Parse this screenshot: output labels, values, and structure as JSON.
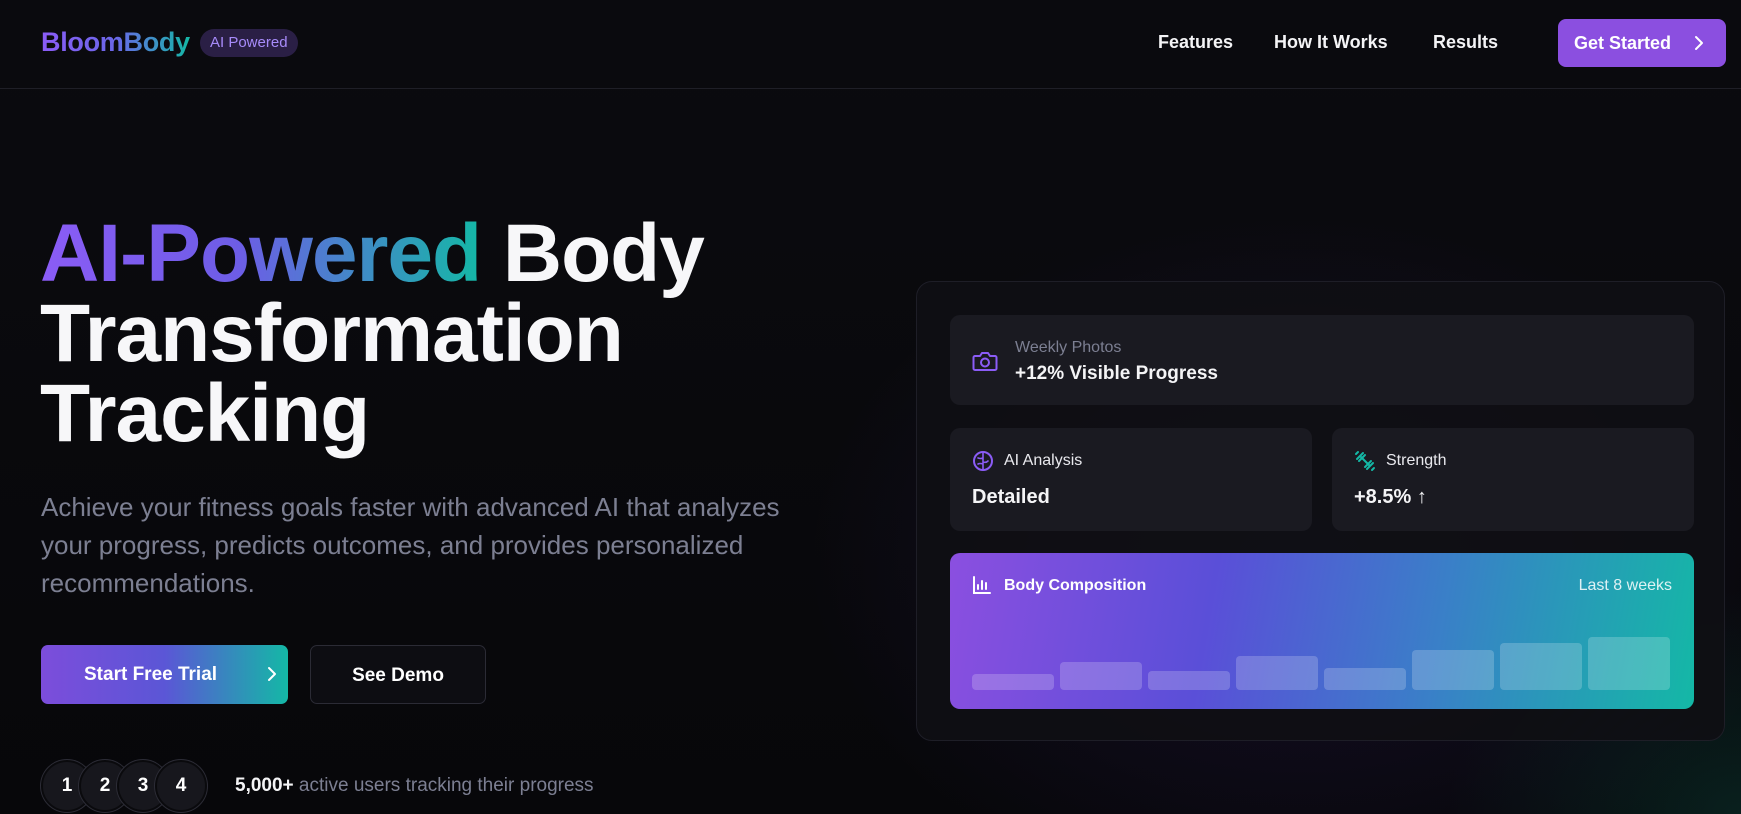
{
  "nav": {
    "logo": "BloomBody",
    "badge": "AI Powered",
    "links": [
      "Features",
      "How It Works",
      "Results"
    ],
    "cta": "Get Started"
  },
  "hero": {
    "title_gradient": "AI-Powered",
    "title_rest_1": " Body",
    "title_line_2": "Transformation",
    "title_line_3": "Tracking",
    "subtitle": "Achieve your fitness goals faster with advanced AI that analyzes your progress, predicts outcomes, and provides personalized recommendations.",
    "primary_button": "Start Free Trial",
    "secondary_button": "See Demo",
    "avatars": [
      "1",
      "2",
      "3",
      "4"
    ],
    "users_count": "5,000+",
    "users_text": " active users tracking their progress"
  },
  "dashboard": {
    "photos": {
      "icon": "camera-icon",
      "label": "Weekly Photos",
      "value": "+12% Visible Progress"
    },
    "ai_analysis": {
      "icon": "brain-icon",
      "label": "AI Analysis",
      "value": "Detailed"
    },
    "strength": {
      "icon": "dumbbell-icon",
      "label": "Strength",
      "value": "+8.5% ↑"
    },
    "body_composition": {
      "icon": "bar-chart-icon",
      "label": "Body Composition",
      "range": "Last 8 weeks",
      "bar_levels": [
        0.25,
        0.45,
        0.3,
        0.55,
        0.35,
        0.65,
        0.75,
        0.85
      ]
    }
  },
  "colors": {
    "accent_purple": "#8b4fe0",
    "accent_teal": "#14b8a6",
    "background": "#08080b",
    "card": "#1a1a21"
  }
}
